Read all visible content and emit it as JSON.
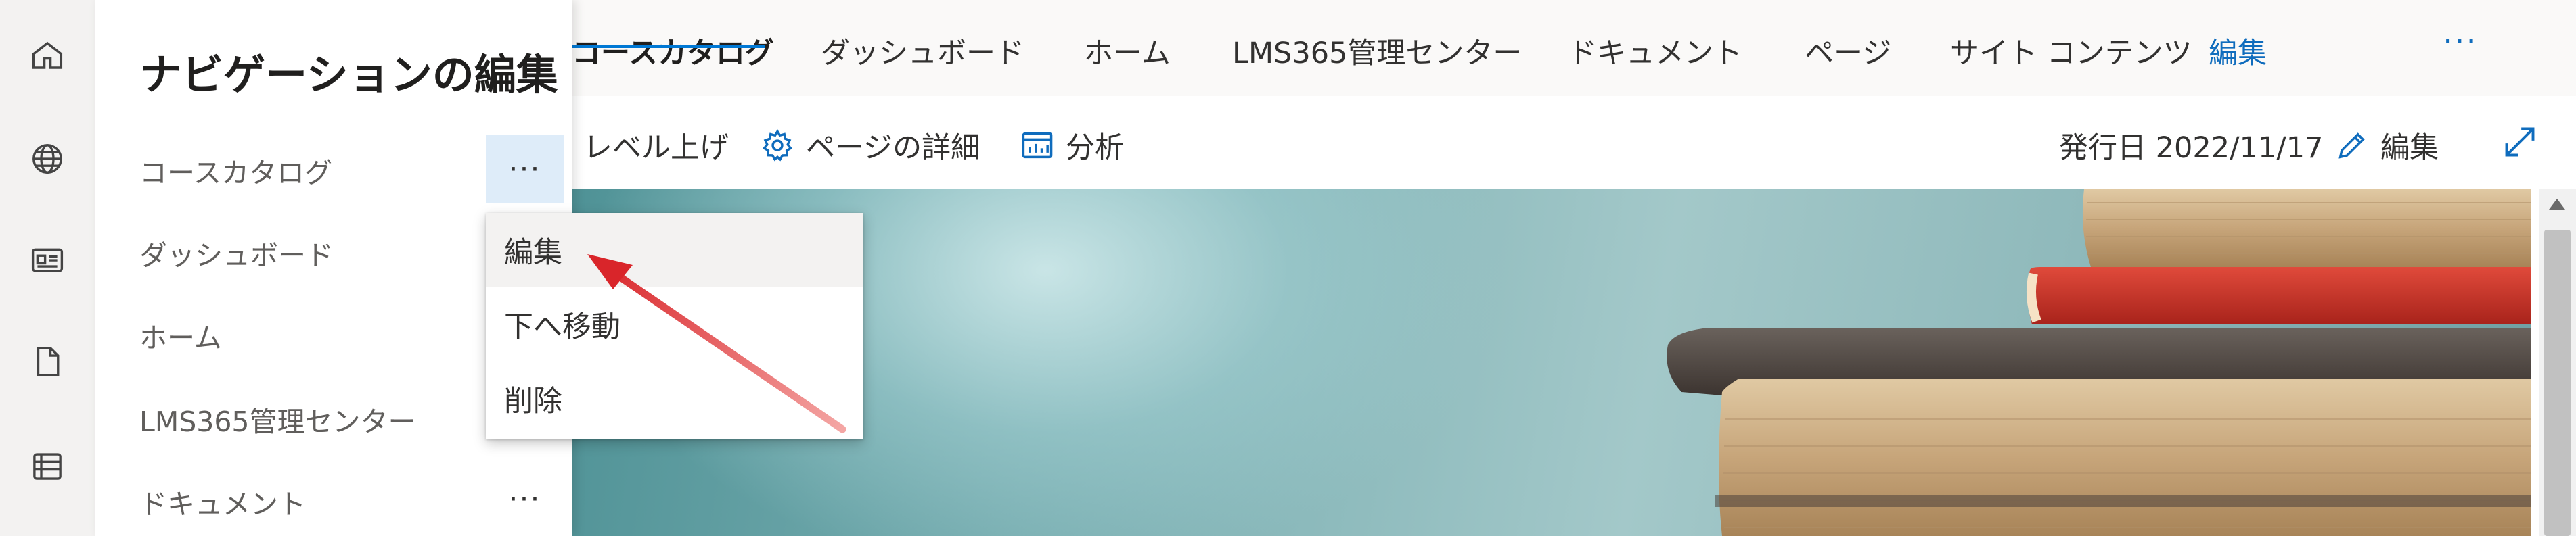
{
  "rail": {
    "icons": [
      "home-icon",
      "globe-icon",
      "news-icon",
      "document-icon",
      "list-icon"
    ]
  },
  "topnav": {
    "items": [
      "コースカタログ",
      "ダッシュボード",
      "ホーム",
      "LMS365管理センター",
      "ドキュメント",
      "ページ",
      "サイト コンテンツ",
      "編集"
    ],
    "more": "···"
  },
  "commandbar": {
    "promote": "レベル上げ",
    "page_details": "ページの詳細",
    "analytics": "分析",
    "published": "発行日 2022/11/17",
    "edit": "編集"
  },
  "panel": {
    "title": "ナビゲーションの編集",
    "items": [
      "コースカタログ",
      "ダッシュボード",
      "ホーム",
      "LMS365管理センター",
      "ドキュメント"
    ],
    "ellipsis": "···"
  },
  "context_menu": {
    "items": [
      "編集",
      "下へ移動",
      "削除"
    ]
  },
  "colors": {
    "accent": "#0078d4",
    "link": "#0f6cbd",
    "annotation_arrow": "#d9252a"
  }
}
